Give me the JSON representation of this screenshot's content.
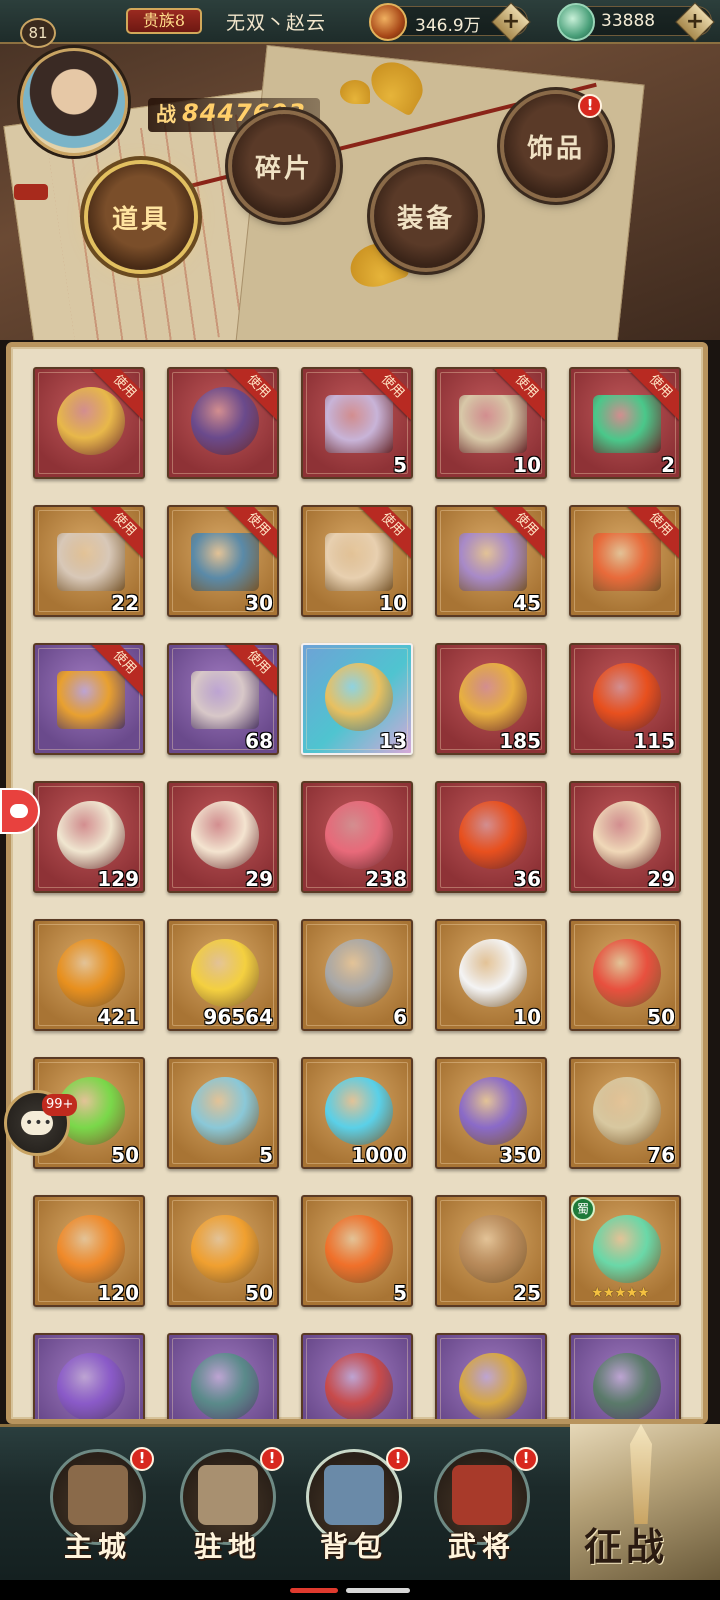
{
  "player": {
    "level": "81",
    "noble": "贵族8",
    "name": "无双丶赵云",
    "power_label": "战",
    "power": "8447603"
  },
  "resources": [
    {
      "icon": "copper-coin-icon",
      "value": "346.9万"
    },
    {
      "icon": "jade-dragon-icon",
      "value": "33888"
    }
  ],
  "tabs": [
    {
      "label": "道具",
      "active": true,
      "alert": false
    },
    {
      "label": "碎片",
      "active": false,
      "alert": false
    },
    {
      "label": "装备",
      "active": false,
      "alert": false
    },
    {
      "label": "饰品",
      "active": false,
      "alert": true
    }
  ],
  "use_label": "使用",
  "alert_symbol": "!",
  "items": [
    {
      "name": "red-card-pack",
      "rarity": "red",
      "use": true,
      "count": "",
      "color": "#e8b84a"
    },
    {
      "name": "gold-card-pack",
      "rarity": "red",
      "use": true,
      "count": "",
      "color": "#6a4a8c"
    },
    {
      "name": "hero-orb-chest-red",
      "rarity": "red",
      "use": true,
      "count": "5",
      "color": "#c8b4d8"
    },
    {
      "name": "hero-orb-chest-red-2",
      "rarity": "red",
      "use": true,
      "count": "10",
      "color": "#d8c8a8"
    },
    {
      "name": "treasure-chest-red",
      "rarity": "red",
      "use": true,
      "count": "2",
      "color": "#4ac88a"
    },
    {
      "name": "hero-orb-chest-gold",
      "rarity": "gold",
      "use": true,
      "count": "22",
      "color": "#d8c8b8"
    },
    {
      "name": "equipment-chest-gold",
      "rarity": "gold",
      "use": true,
      "count": "30",
      "color": "#5a8aa8"
    },
    {
      "name": "hero-orb-chest-gold-2",
      "rarity": "gold",
      "use": true,
      "count": "10",
      "color": "#e8d0b0"
    },
    {
      "name": "accessory-chest-gold",
      "rarity": "gold",
      "use": true,
      "count": "45",
      "color": "#a88ac8"
    },
    {
      "name": "treasure-chest-gold",
      "rarity": "gold",
      "use": true,
      "count": "",
      "color": "#e86a3a"
    },
    {
      "name": "gem-chest-purple",
      "rarity": "purple",
      "use": true,
      "count": "",
      "color": "#e8a030"
    },
    {
      "name": "hero-orb-chest-purple",
      "rarity": "purple",
      "use": true,
      "count": "68",
      "color": "#d8c8c8"
    },
    {
      "name": "blue-crystal-crown",
      "rarity": "blue",
      "use": false,
      "count": "13",
      "color": "#e8c060"
    },
    {
      "name": "dragon-seal-coin",
      "rarity": "red",
      "use": false,
      "count": "185",
      "color": "#e8b040"
    },
    {
      "name": "red-dragon-token",
      "rarity": "red",
      "use": false,
      "count": "115",
      "color": "#e8501e"
    },
    {
      "name": "ivory-horn",
      "rarity": "red",
      "use": false,
      "count": "129",
      "color": "#f0e6d0"
    },
    {
      "name": "scallop-shell",
      "rarity": "red",
      "use": false,
      "count": "29",
      "color": "#f4e4d0"
    },
    {
      "name": "red-qilin-jade",
      "rarity": "red",
      "use": false,
      "count": "238",
      "color": "#e86a7a"
    },
    {
      "name": "red-gem-pendant",
      "rarity": "red",
      "use": false,
      "count": "36",
      "color": "#e8501e"
    },
    {
      "name": "dragon-card-token",
      "rarity": "red",
      "use": false,
      "count": "29",
      "color": "#f0d8b8"
    },
    {
      "name": "golden-token",
      "rarity": "gold",
      "use": false,
      "count": "421",
      "color": "#e8901e"
    },
    {
      "name": "golden-pearl-stand",
      "rarity": "gold",
      "use": false,
      "count": "96564",
      "color": "#f4d040"
    },
    {
      "name": "spear-head",
      "rarity": "gold",
      "use": false,
      "count": "6",
      "color": "#a8a8a8"
    },
    {
      "name": "yin-yang-ring",
      "rarity": "gold",
      "use": false,
      "count": "10",
      "color": "#f4f4f4"
    },
    {
      "name": "red-crystal",
      "rarity": "gold",
      "use": false,
      "count": "50",
      "color": "#e8503e"
    },
    {
      "name": "green-crystal",
      "rarity": "gold",
      "use": false,
      "count": "50",
      "color": "#7ad84a"
    },
    {
      "name": "jade-fish",
      "rarity": "gold",
      "use": false,
      "count": "5",
      "color": "#8ac8d8"
    },
    {
      "name": "blue-gem-amulet",
      "rarity": "gold",
      "use": false,
      "count": "1000",
      "color": "#5ad0e8"
    },
    {
      "name": "purple-cloth",
      "rarity": "gold",
      "use": false,
      "count": "350",
      "color": "#8a6ac8"
    },
    {
      "name": "bronze-disc",
      "rarity": "gold",
      "use": false,
      "count": "76",
      "color": "#d8c8a0"
    },
    {
      "name": "fire-orb",
      "rarity": "gold",
      "use": false,
      "count": "120",
      "color": "#f08a2a"
    },
    {
      "name": "amber-crystal",
      "rarity": "gold",
      "use": false,
      "count": "50",
      "color": "#f0a030"
    },
    {
      "name": "flame-brazier",
      "rarity": "gold",
      "use": false,
      "count": "5",
      "color": "#f0702a"
    },
    {
      "name": "wooden-branch",
      "rarity": "gold",
      "use": false,
      "count": "25",
      "color": "#b88a5a"
    },
    {
      "name": "shu-jade-orb",
      "rarity": "gold",
      "use": false,
      "count": "",
      "color": "#6ad8a8",
      "faction": "蜀",
      "stars": 5
    },
    {
      "name": "purple-token",
      "rarity": "purple",
      "use": false,
      "count": "",
      "color": "#8a5ac8"
    },
    {
      "name": "purple-spear",
      "rarity": "purple",
      "use": false,
      "count": "",
      "color": "#5a8a8a"
    },
    {
      "name": "purple-scroll",
      "rarity": "purple",
      "use": false,
      "count": "",
      "color": "#c84a4a"
    },
    {
      "name": "armillary-sphere",
      "rarity": "purple",
      "use": false,
      "count": "",
      "color": "#d8a840"
    },
    {
      "name": "jade-key",
      "rarity": "purple",
      "use": false,
      "count": "",
      "color": "#5a7a6a"
    }
  ],
  "chat": {
    "badge": "99+"
  },
  "nav": [
    {
      "label": "主城",
      "icon": "city-icon",
      "alert": true,
      "color": "#8a6a4a"
    },
    {
      "label": "驻地",
      "icon": "garrison-icon",
      "alert": true,
      "color": "#a89070"
    },
    {
      "label": "背包",
      "icon": "backpack-icon",
      "alert": true,
      "color": "#6a8aa8"
    },
    {
      "label": "武将",
      "icon": "general-icon",
      "alert": true,
      "color": "#a83a2a"
    }
  ],
  "battle": {
    "label": "征战"
  }
}
